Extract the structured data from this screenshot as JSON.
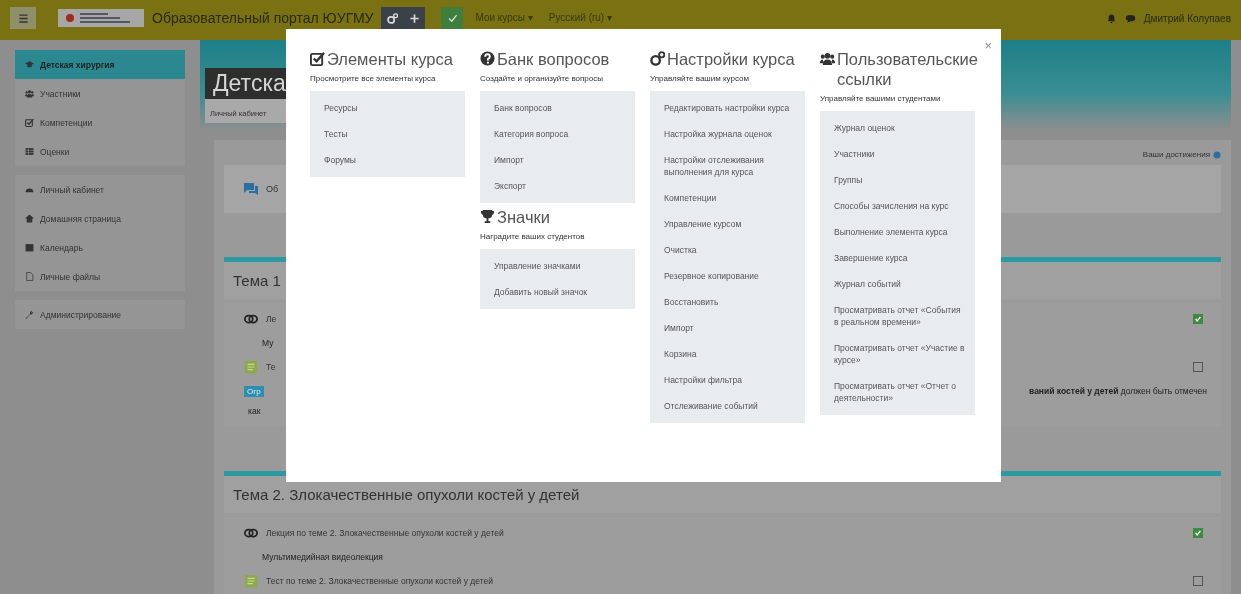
{
  "top_bar": {
    "site_title": "Образовательный портал ЮУГМУ",
    "menus": [
      "Мои курсы ▾",
      "Русский (ru) ▾"
    ],
    "user_name": "Дмитрий Колупаев"
  },
  "sidebar": {
    "groups": [
      {
        "items": [
          {
            "label": "Детская хирургия",
            "selected": true
          },
          {
            "label": "Участники",
            "selected": false
          },
          {
            "label": "Компетенции",
            "selected": false
          },
          {
            "label": "Оценки",
            "selected": false
          }
        ]
      },
      {
        "items": [
          {
            "label": "Личный кабинет",
            "selected": false
          },
          {
            "label": "Домашняя страница",
            "selected": false
          },
          {
            "label": "Календарь",
            "selected": false
          },
          {
            "label": "Личные файлы",
            "selected": false
          }
        ]
      },
      {
        "items": [
          {
            "label": "Администрирование",
            "selected": false
          }
        ]
      }
    ]
  },
  "header": {
    "title": "Детска",
    "breadcrumb": "Личный кабинет"
  },
  "achievements": "Ваши достижения",
  "forum": {
    "title": "Об"
  },
  "sections": [
    {
      "title": "Тема 1",
      "rows": [
        {
          "kind": "link",
          "title": "Ле",
          "completed": true
        },
        {
          "kind": "note",
          "title": "Му"
        },
        {
          "kind": "quiz",
          "title": "Те",
          "completed": false
        },
        {
          "kind": "restriction",
          "badge": "Огр",
          "tail": "**ваний костей у детей** должен быть отмечен",
          "line_2": "как"
        }
      ]
    },
    {
      "title": "Тема 2. Злокачественные опухоли костей у детей",
      "rows": [
        {
          "kind": "link",
          "title": "Лекция по теме 2. Злокачественные опухоли костей у детей",
          "completed": true
        },
        {
          "kind": "note",
          "title": "Мультимедийная видеолекция"
        },
        {
          "kind": "quiz",
          "title": "Тест по теме 2. Злокачественные опухоли костей у детей",
          "completed": false
        }
      ]
    }
  ],
  "modal": {
    "close": "×",
    "columns": [
      {
        "sections": [
          {
            "title": "Элементы курса",
            "description": "Просмотрите все элементы курса",
            "links": [
              "Ресурсы",
              "Тесты",
              "Форумы"
            ]
          }
        ]
      },
      {
        "sections": [
          {
            "title": "Банк вопросов",
            "description": "Создайте и организуйте вопросы",
            "links": [
              "Банк вопросов",
              "Категория вопроса",
              "Импорт",
              "Экспорт"
            ]
          },
          {
            "title": "Значки",
            "description": "Наградите ваших студентов",
            "links": [
              "Управление значками",
              "Добавить новый значок"
            ]
          }
        ]
      },
      {
        "sections": [
          {
            "title": "Настройки курса",
            "description": "Управляйте вашим курсом",
            "links": [
              "Редактировать настройки курса",
              "Настройка журнала оценок",
              "Настройки отслеживания выполнения для курса",
              "Компетенции",
              "Управление курсом",
              "Очистка",
              "Резервное копирование",
              "Восстановить",
              "Импорт",
              "Корзина",
              "Настройки фильтра",
              "Отслеживание событий"
            ]
          }
        ]
      },
      {
        "sections": [
          {
            "title": "Пользовательские ссылки",
            "description": "Управляйте вашими студентами",
            "links": [
              "Журнал оценок",
              "Участники",
              "Группы",
              "Способы зачисления на курс",
              "Выполнение элемента курса",
              "Завершение курса",
              "Журнал событий",
              "Просматривать отчет «События в реальном времени»",
              "Просматривать отчет «Участие в курсе»",
              "Просматривать отчет «Отчет о деятельности»"
            ]
          }
        ]
      }
    ]
  }
}
